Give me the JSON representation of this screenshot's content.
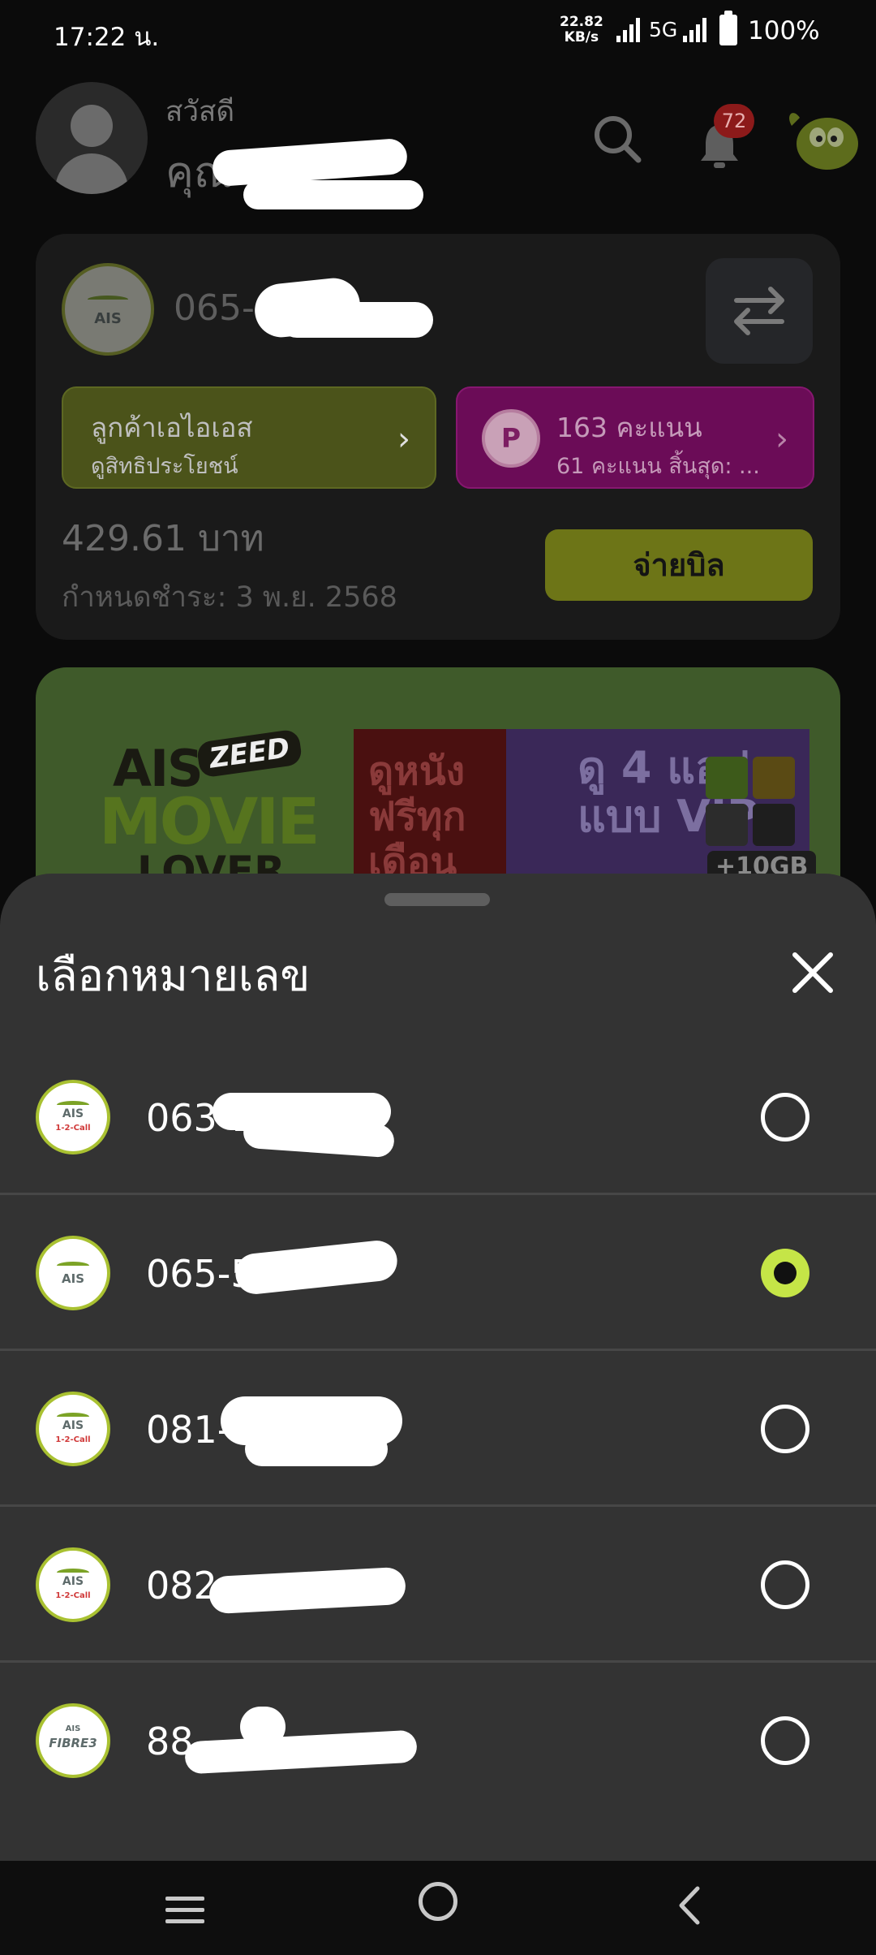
{
  "status_bar": {
    "time": "17:22 น.",
    "speed_value": "22.82",
    "speed_unit": "KB/s",
    "network": "5G",
    "battery": "100%"
  },
  "header": {
    "greeting": "สวัสดี",
    "name_prefix": "คุณ",
    "notification_count": "72",
    "icons": [
      "search-icon",
      "bell-icon",
      "mascot-icon"
    ]
  },
  "account_card": {
    "logo_text": "AIS",
    "phone_prefix": "065-",
    "customer_pill": {
      "title": "ลูกค้าเอไอเอส",
      "subtitle": "ดูสิทธิประโยชน์"
    },
    "points_pill": {
      "badge": "P",
      "title": "163 คะแนน",
      "subtitle": "61 คะแนน สิ้นสุด: ..."
    },
    "amount": "429.61 บาท",
    "due_date": "กำหนดชำระ: 3 พ.ย. 2568",
    "pay_button": "จ่ายบิล"
  },
  "banner": {
    "brand_ais": "AIS",
    "brand_zeed": "ZEED",
    "brand_movie": "MOVIE",
    "brand_lover": "LOVER",
    "promo_left": "ดูหนังฟรีทุกเดือน",
    "promo_right_1": "ดู 4 แอป",
    "promo_right_2": "แบบ VIP",
    "promo_extra": "+10GB"
  },
  "sheet": {
    "title": "เลือกหมายเลข",
    "numbers": [
      {
        "number": "063-14",
        "logo_text": "AIS",
        "logo_sub": "1-2-Call",
        "selected": false
      },
      {
        "number": "065-5",
        "logo_text": "AIS",
        "logo_sub": "",
        "selected": true
      },
      {
        "number": "081-",
        "logo_text": "AIS",
        "logo_sub": "1-2-Call",
        "selected": false
      },
      {
        "number": "082",
        "logo_text": "AIS",
        "logo_sub": "1-2-Call",
        "selected": false
      },
      {
        "number": "88",
        "logo_text": "FIBRE3",
        "logo_sub": "AIS",
        "selected": false
      }
    ]
  },
  "colors": {
    "accent_green": "#c5e547",
    "sheet_bg": "#333333",
    "pink": "#6b0c57"
  }
}
